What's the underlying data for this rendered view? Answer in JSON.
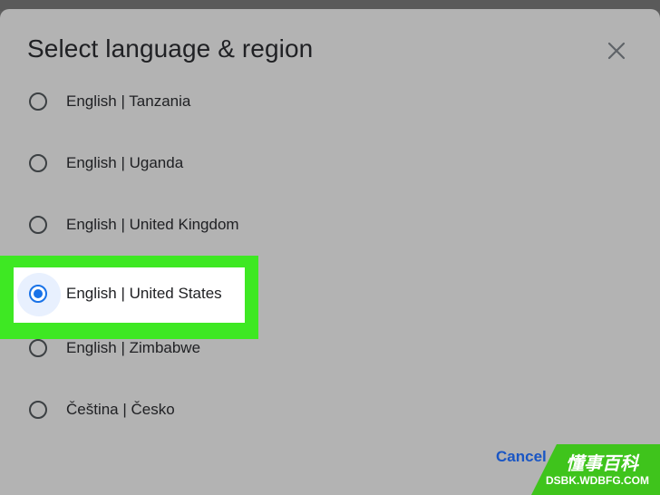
{
  "dialog": {
    "title": "Select language & region",
    "close_icon": "close-icon",
    "cancel_label": "Cancel"
  },
  "options": [
    {
      "label": "English | Tanzania",
      "selected": false
    },
    {
      "label": "English | Uganda",
      "selected": false
    },
    {
      "label": "English | United Kingdom",
      "selected": false
    },
    {
      "label": "English | United States",
      "selected": true
    },
    {
      "label": "English | Zimbabwe",
      "selected": false
    },
    {
      "label": "Čeština | Česko",
      "selected": false
    }
  ],
  "watermark": {
    "text_cn": "懂事百科",
    "text_en": "DSBK.WDBFG.COM"
  },
  "colors": {
    "overlay": "#b3b3b3",
    "accent": "#1a73e8",
    "highlight": "#3ee823",
    "watermark": "#3fc41c"
  }
}
